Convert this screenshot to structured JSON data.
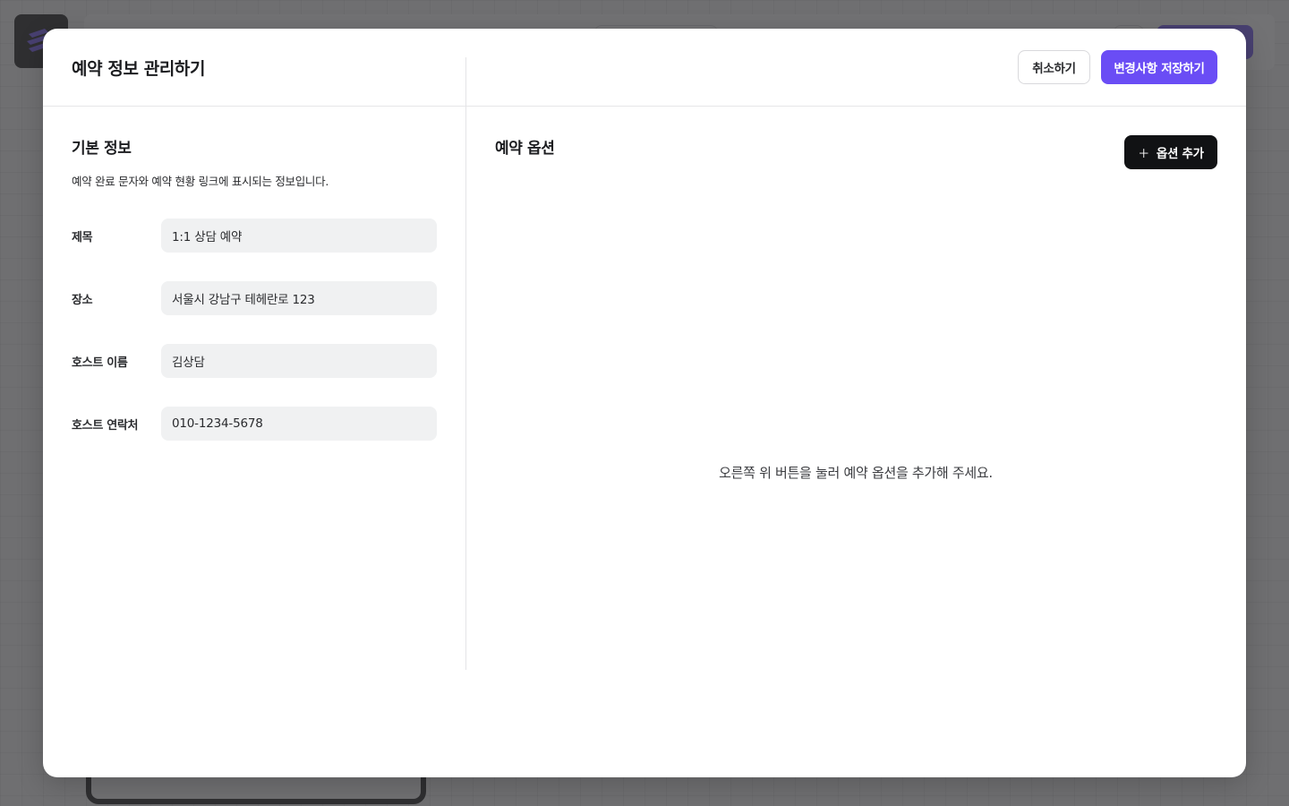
{
  "modal": {
    "title": "예약 정보 관리하기",
    "cancel_label": "취소하기",
    "save_label": "변경사항 저장하기"
  },
  "basic_info": {
    "title": "기본 정보",
    "description": "예약 완료 문자와 예약 현황 링크에 표시되는 정보입니다.",
    "fields": [
      {
        "label": "제목",
        "value": "1:1 상담 예약"
      },
      {
        "label": "장소",
        "value": "서울시 강남구 테헤란로 123"
      },
      {
        "label": "호스트 이름",
        "value": "김상담"
      },
      {
        "label": "호스트 연락처",
        "value": "010-1234-5678"
      }
    ]
  },
  "options": {
    "title": "예약 옵션",
    "add_label": "옵션 추가",
    "add_icon": "plus-icon",
    "empty_message": "오른쪽 위 버튼을 눌러 예약 옵션을 추가해 주세요."
  },
  "colors": {
    "primary": "#6a4df5",
    "dark_button": "#111214",
    "input_bg": "#f0f1f2"
  }
}
